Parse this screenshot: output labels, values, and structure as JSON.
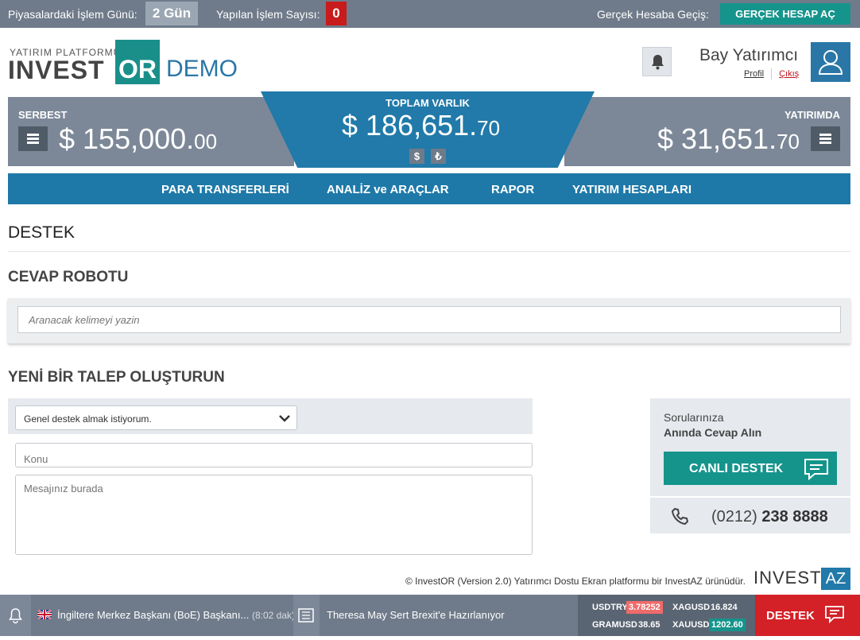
{
  "topbar": {
    "days_label": "Piyasalardaki İşlem Günü:",
    "days_value": "2 Gün",
    "trades_label": "Yapılan İşlem Sayısı:",
    "trades_value": "0",
    "real_label": "Gerçek Hesaba Geçiş:",
    "real_button": "GERÇEK HESAP AÇ"
  },
  "logo": {
    "small": "YATIRIM PLATFORMU",
    "invest": "INVEST",
    "or": "OR",
    "demo": "DEMO"
  },
  "user": {
    "name": "Bay Yatırımcı",
    "profile": "Profil",
    "logout": "Çıkış"
  },
  "balances": {
    "serbest_label": "SERBEST",
    "serbest_main": "$ 155,000.",
    "serbest_cents": "00",
    "toplam_label": "TOPLAM VARLIK",
    "toplam_main": "$ 186,651.",
    "toplam_cents": "70",
    "usd_symbol": "$",
    "try_symbol": "₺",
    "yatirimda_label": "YATIRIMDA",
    "yatirimda_main": "$ 31,651.",
    "yatirimda_cents": "70"
  },
  "nav": [
    "PARA TRANSFERLERİ",
    "ANALİZ ve ARAÇLAR",
    "RAPOR",
    "YATIRIM HESAPLARI"
  ],
  "page": {
    "title": "DESTEK",
    "robot_title": "CEVAP ROBOTU",
    "search_placeholder": "Aranacak kelimeyi yazin",
    "new_title": "YENİ BİR TALEP OLUŞTURUN"
  },
  "form": {
    "select_value": "Genel destek almak istiyorum.",
    "subject_placeholder": "Konu",
    "message_placeholder": "Mesajınız burada"
  },
  "support": {
    "line1": "Sorularınıza",
    "line2": "Anında Cevap Alın",
    "live_button": "CANLI DESTEK",
    "phone_area": "(0212)",
    "phone_number": "238 8888"
  },
  "footer": {
    "text": "© InvestOR (Version 2.0) Yatırımcı Dostu Ekran platformu bir InvestAZ ürünüdür.",
    "brand": "INVEST",
    "brand2": "AZ"
  },
  "bottom": {
    "news1": "İngiltere Merkez Başkanı (BoE) Başkanı...",
    "news1_time": "(8:02 dak)",
    "news2": "Theresa May Sert Brexit'e Hazırlanıyor",
    "rates": {
      "usdtry_label": "USDTRY",
      "usdtry": "3.78252",
      "xagusd_label": "XAGUSD",
      "xagusd": "16.824",
      "gramusd_label": "GRAMUSD",
      "gramusd": "38.65",
      "xauusd_label": "XAUUSD",
      "xauusd": "1202.60"
    },
    "destek": "DESTEK"
  },
  "colors": {
    "teal": "#15948c",
    "blue": "#217aa9",
    "slate": "#7c8898",
    "red": "#d42027"
  }
}
